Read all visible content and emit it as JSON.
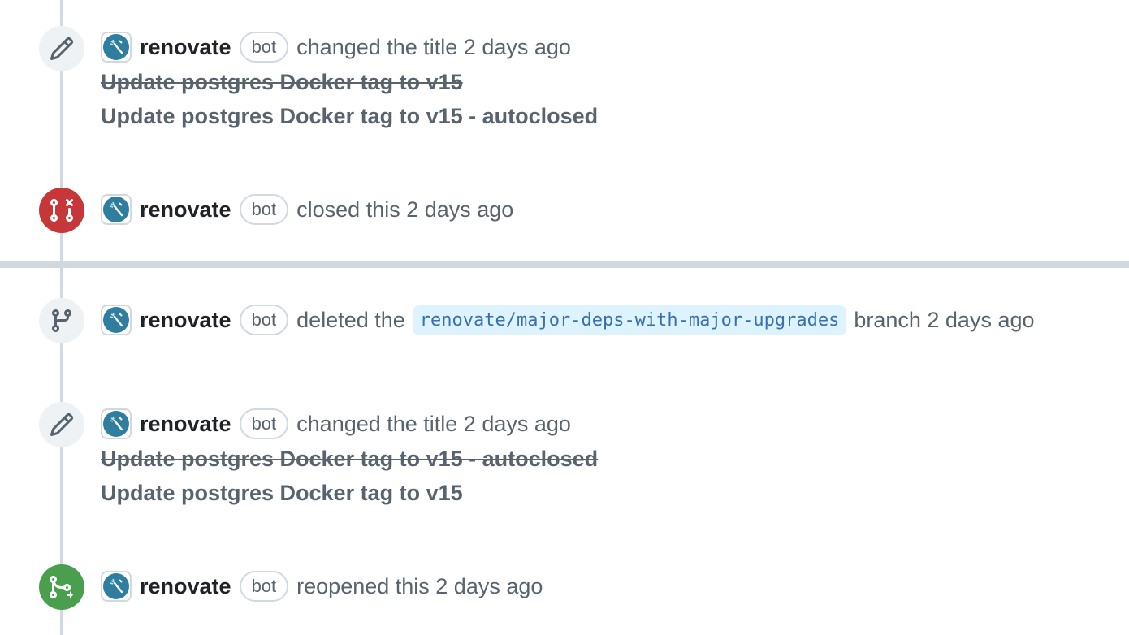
{
  "colors": {
    "rail": "#d1d9e0",
    "closed_badge": "#c6373a",
    "reopened_badge": "#4a9f4f",
    "branch_bg": "#ddf4ff",
    "branch_text": "#3b6fb0"
  },
  "events": [
    {
      "icon": "pencil-icon",
      "author": "renovate",
      "badge": "bot",
      "action": "changed the title 2 days ago",
      "old_title": "Update postgres Docker tag to v15",
      "new_title": "Update postgres Docker tag to v15 - autoclosed"
    },
    {
      "icon": "pull-request-closed-icon",
      "author": "renovate",
      "badge": "bot",
      "action": "closed this 2 days ago"
    },
    {
      "icon": "git-branch-icon",
      "author": "renovate",
      "badge": "bot",
      "action_before": "deleted the",
      "branch": "renovate/major-deps-with-major-upgrades",
      "action_after": "branch 2 days ago"
    },
    {
      "icon": "pencil-icon",
      "author": "renovate",
      "badge": "bot",
      "action": "changed the title 2 days ago",
      "old_title": "Update postgres Docker tag to v15 - autoclosed",
      "new_title": "Update postgres Docker tag to v15"
    },
    {
      "icon": "pull-request-reopened-icon",
      "author": "renovate",
      "badge": "bot",
      "action": "reopened this 2 days ago"
    }
  ]
}
